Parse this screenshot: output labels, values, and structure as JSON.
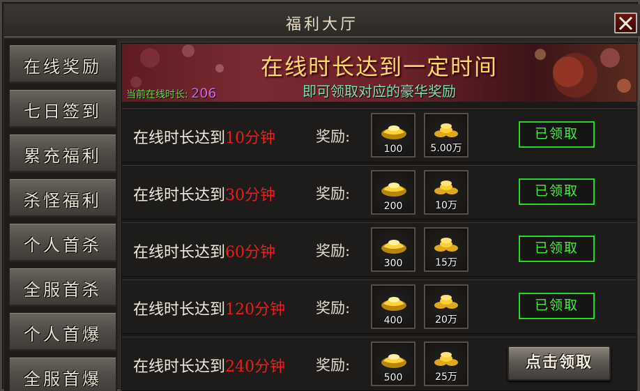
{
  "window": {
    "title": "福利大厅"
  },
  "sidebar": {
    "items": [
      {
        "label": "在线奖励"
      },
      {
        "label": "七日签到"
      },
      {
        "label": "累充福利"
      },
      {
        "label": "杀怪福利"
      },
      {
        "label": "个人首杀"
      },
      {
        "label": "全服首杀"
      },
      {
        "label": "个人首爆"
      },
      {
        "label": "全服首爆"
      }
    ]
  },
  "banner": {
    "title": "在线时长达到一定时间",
    "subtitle": "即可领取对应的豪华奖励",
    "online_label": "当前在线时长:",
    "online_value": "206"
  },
  "rewards": {
    "reward_label": "奖励:",
    "rows": [
      {
        "prefix": "在线时长达到",
        "minutes": "10分钟",
        "ingot_qty": "100",
        "gold_qty": "5.00万",
        "status": "已领取"
      },
      {
        "prefix": "在线时长达到",
        "minutes": "30分钟",
        "ingot_qty": "200",
        "gold_qty": "10万",
        "status": "已领取"
      },
      {
        "prefix": "在线时长达到",
        "minutes": "60分钟",
        "ingot_qty": "300",
        "gold_qty": "15万",
        "status": "已领取"
      },
      {
        "prefix": "在线时长达到",
        "minutes": "120分钟",
        "ingot_qty": "400",
        "gold_qty": "20万",
        "status": "已领取"
      },
      {
        "prefix": "在线时长达到",
        "minutes": "240分钟",
        "ingot_qty": "500",
        "gold_qty": "25万",
        "action": "点击领取"
      }
    ]
  },
  "icons": {
    "close": "close-icon",
    "ingot": "gold-ingot-icon",
    "coins": "gold-coins-icon"
  },
  "colors": {
    "minutes": "#ee1c1c",
    "claimed": "#3ef23c",
    "banner_title": "#ffd86a",
    "banner_subtitle": "#7be3b2",
    "online_label": "#6ddc3a",
    "online_value": "#e05ce8"
  }
}
